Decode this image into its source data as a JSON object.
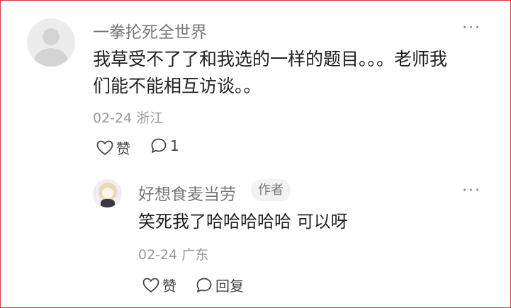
{
  "comment": {
    "username": "一拳抡死全世界",
    "more_label": "···",
    "text_line1": "我草受不了了和我选的一样的题目。。。老师我",
    "text_line2": "们能不能相互访谈。。",
    "date_location": "02-24 浙江",
    "like_label": "赞",
    "reply_count": "1"
  },
  "reply": {
    "username": "好想食麦当劳",
    "author_badge": "作者",
    "more_label": "···",
    "text": "笑死我了哈哈哈哈哈 可以呀",
    "date_location": "02-24 广东",
    "like_label": "赞",
    "reply_label": "回复"
  },
  "icons": {
    "like": "heart-icon",
    "comment": "speech-bubble-icon",
    "more": "more-dots-icon"
  }
}
